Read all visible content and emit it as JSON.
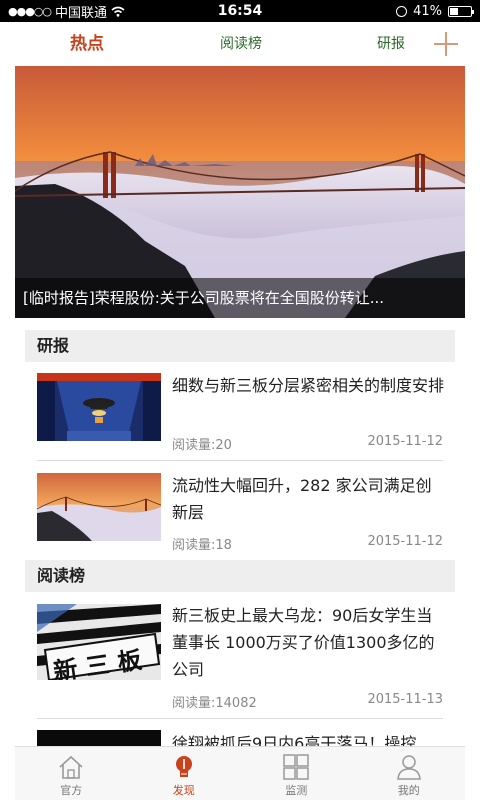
{
  "status_bar": {
    "signal": "●●●○○",
    "carrier": "中国联通",
    "time": "16:54",
    "battery": "41%",
    "battery_level": 0.41
  },
  "top_nav": {
    "tabs": [
      {
        "label": "热点",
        "active": true
      },
      {
        "label": "阅读榜",
        "active": false
      },
      {
        "label": "研报",
        "active": false
      }
    ]
  },
  "hero": {
    "caption": "[临时报告]荣程股份:关于公司股票将在全国股份转让..."
  },
  "sections": {
    "research": {
      "title": "研报",
      "items": [
        {
          "title": "细数与新三板分层紧密相关的制度安排",
          "reads": "阅读量:20",
          "date": "2015-11-12"
        },
        {
          "title": "流动性大幅回升，282 家公司满足创新层",
          "reads": "阅读量:18",
          "date": "2015-11-12"
        }
      ]
    },
    "ranking": {
      "title": "阅读榜",
      "items": [
        {
          "title": "新三板史上最大乌龙：90后女学生当董事长 1000万买了价值1300多亿的公司",
          "reads": "阅读量:14082",
          "date": "2015-11-13",
          "thumb_text": "新 三 板"
        },
        {
          "title": "徐翔被抓后9日内6高干落马！操控"
        }
      ]
    }
  },
  "tab_bar": {
    "tabs": [
      {
        "label": "官方",
        "icon": "home-icon"
      },
      {
        "label": "发现",
        "icon": "bulb-icon",
        "active": true
      },
      {
        "label": "监测",
        "icon": "grid-icon"
      },
      {
        "label": "我的",
        "icon": "person-icon"
      }
    ]
  },
  "colors": {
    "accent": "#c8431c",
    "nav_green": "#2a6a2a",
    "section_bg": "#eeeeee"
  }
}
